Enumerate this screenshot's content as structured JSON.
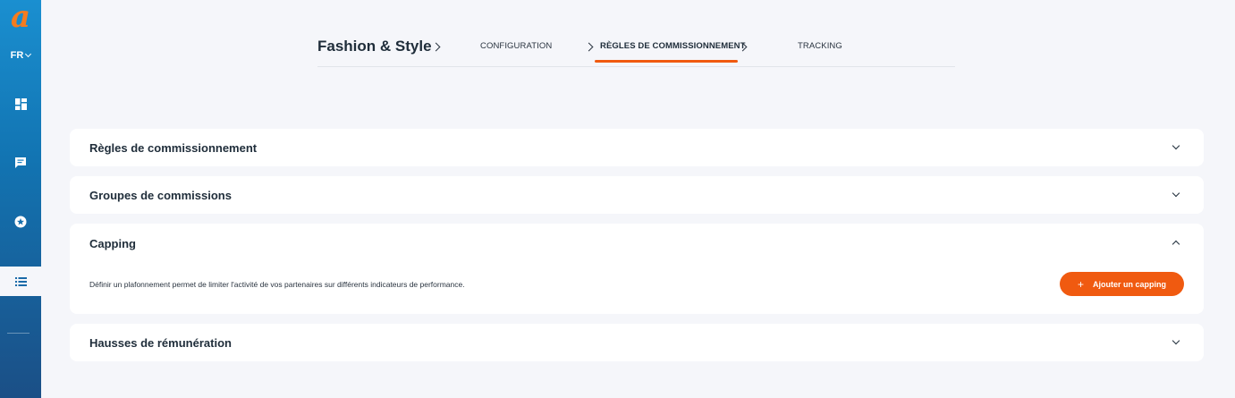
{
  "sidebar": {
    "logo_letter": "a",
    "language": "FR",
    "items": [
      {
        "icon": "dashboard-icon"
      },
      {
        "icon": "chat-icon"
      },
      {
        "icon": "star-badge-icon"
      },
      {
        "icon": "list-icon",
        "active": true
      }
    ],
    "accent_color": "#f47c20"
  },
  "topnav": {
    "brand": "Fashion & Style",
    "tabs": [
      {
        "label": "CONFIGURATION"
      },
      {
        "label": "RÈGLES DE COMMISSIONNEMENT",
        "active": true
      },
      {
        "label": "TRACKING"
      }
    ],
    "active_color": "#f05a10"
  },
  "sections": [
    {
      "title": "Règles de commissionnement",
      "expanded": false
    },
    {
      "title": "Groupes de commissions",
      "expanded": false
    },
    {
      "title": "Capping",
      "expanded": true,
      "description": "Définir un plafonnement permet de limiter l'activité de vos partenaires sur différents indicateurs de performance.",
      "button_label": "Ajouter un capping"
    },
    {
      "title": "Hausses de rémunération",
      "expanded": false
    }
  ]
}
